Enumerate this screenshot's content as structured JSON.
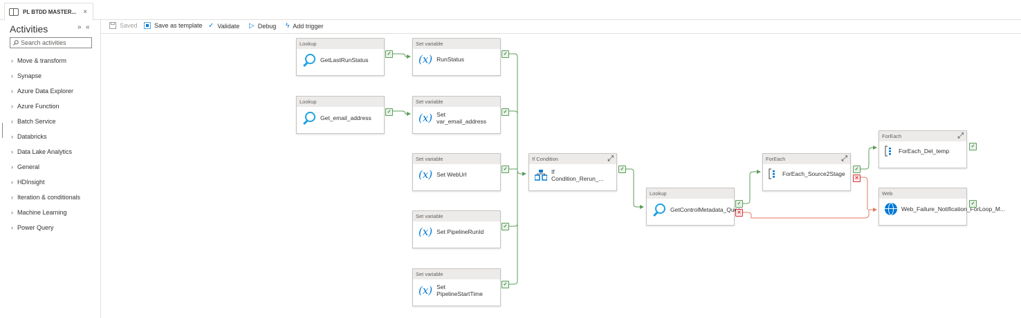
{
  "tab": {
    "title": "PL BTDD MASTER...",
    "close": "×"
  },
  "sidebar": {
    "title": "Activities",
    "collapse_icons": [
      "»",
      "«"
    ],
    "search_placeholder": "Search activities",
    "categories": [
      "Move & transform",
      "Synapse",
      "Azure Data Explorer",
      "Azure Function",
      "Batch Service",
      "Databricks",
      "Data Lake Analytics",
      "General",
      "HDInsight",
      "Iteration & conditionals",
      "Machine Learning",
      "Power Query"
    ]
  },
  "toolbar": {
    "saved": "Saved",
    "save_template": "Save as template",
    "validate": "Validate",
    "debug": "Debug",
    "add_trigger": "Add trigger"
  },
  "nodes": {
    "lookup1": {
      "type": "Lookup",
      "name": "GetLastRunStatus"
    },
    "lookup2": {
      "type": "Lookup",
      "name": "Get_email_address"
    },
    "setvar1": {
      "type": "Set variable",
      "name": "RunStatus"
    },
    "setvar2": {
      "type": "Set variable",
      "name": "Set var_email_address"
    },
    "setvar3": {
      "type": "Set variable",
      "name": "Set WebUrl"
    },
    "setvar4": {
      "type": "Set variable",
      "name": "Set PipelineRunId"
    },
    "setvar5": {
      "type": "Set variable",
      "name": "Set PipelineStartTime"
    },
    "ifcond": {
      "type": "If Condition",
      "name": "If Condition_Rerun_..."
    },
    "lookup3": {
      "type": "Lookup",
      "name": "GetControlMetadata_Query"
    },
    "foreach1": {
      "type": "ForEach",
      "name": "ForEach_Source2Stage"
    },
    "foreach2": {
      "type": "ForEach",
      "name": "ForEach_Del_temp"
    },
    "web1": {
      "type": "Web",
      "name": "Web_Failure_Notification_ForLoop_M..."
    }
  },
  "colors": {
    "success": "#5b9e5b",
    "failure": "#e07a5f",
    "accent": "#0078d4"
  }
}
